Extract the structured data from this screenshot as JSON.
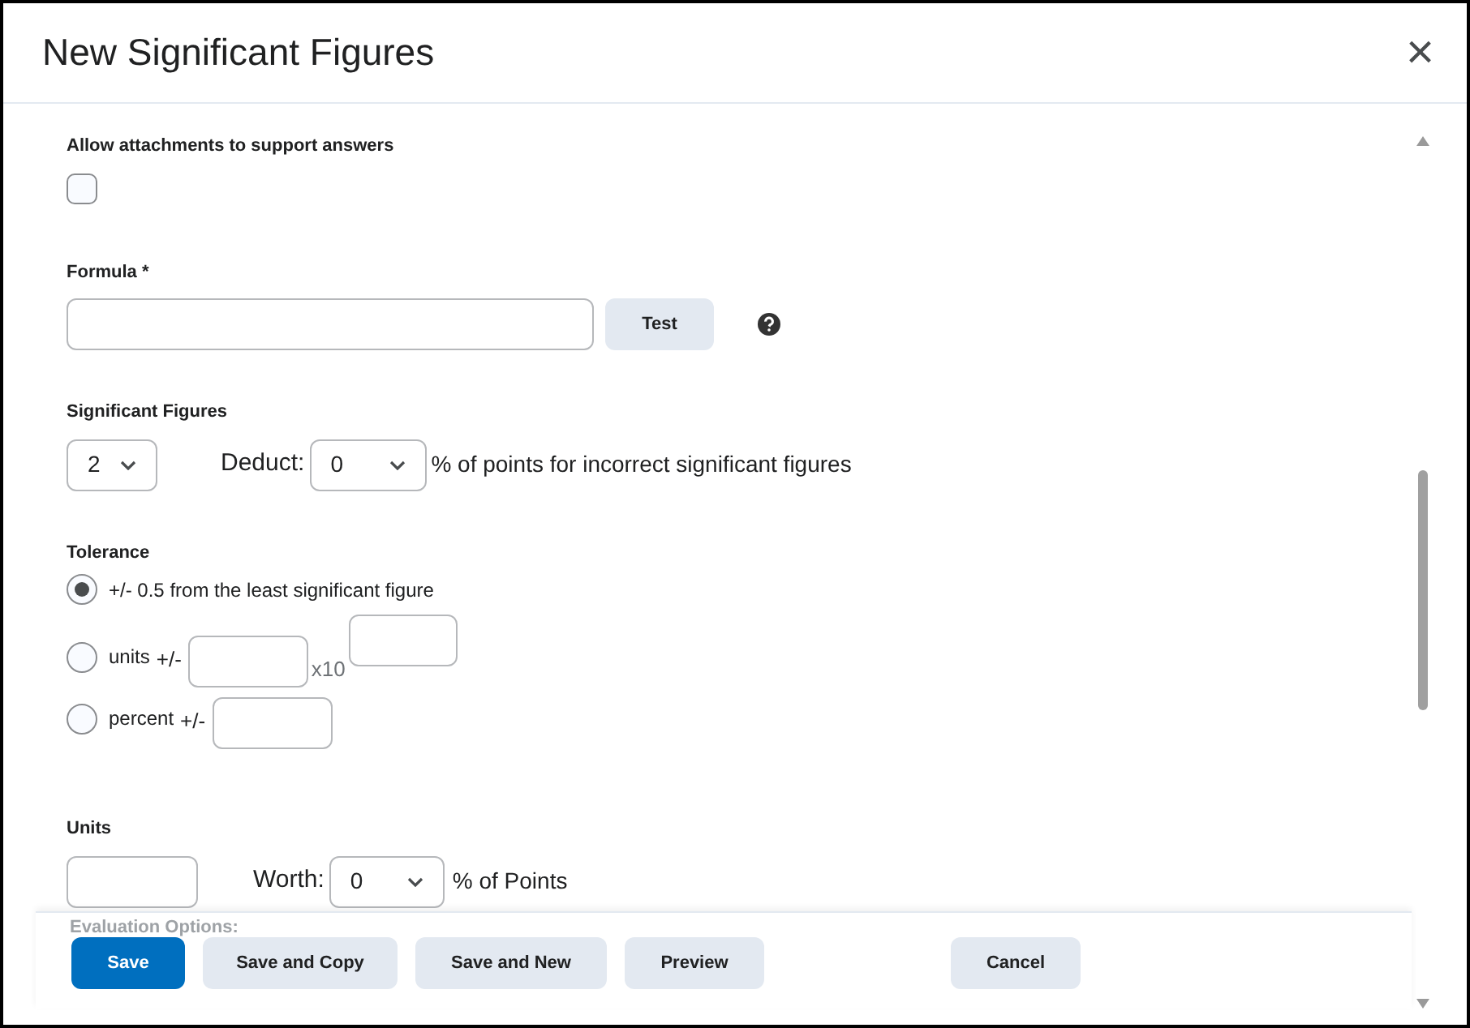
{
  "window": {
    "title": "New Significant Figures",
    "close": "×"
  },
  "attachments": {
    "label": "Allow attachments to support answers",
    "checked": false
  },
  "formula": {
    "label": "Formula *",
    "test_button": "Test"
  },
  "significant_figures": {
    "label": "Significant Figures",
    "value": "2",
    "deduct_label": "Deduct:",
    "deduct_value": "0",
    "deduct_suffix": "% of points for incorrect significant figures"
  },
  "tolerance": {
    "label": "Tolerance",
    "options": [
      {
        "kind": "plain",
        "label": "+/- 0.5 from the least significant figure",
        "selected": true
      },
      {
        "kind": "units",
        "label": "units",
        "prefix": "+/-",
        "exponent_label": "x10",
        "selected": false
      },
      {
        "kind": "percent",
        "label": "percent",
        "prefix": "+/-",
        "selected": false
      }
    ]
  },
  "units": {
    "label": "Units",
    "worth_label": "Worth:",
    "worth_value": "0",
    "worth_suffix": "% of Points"
  },
  "evaluation_options": {
    "label": "Evaluation Options:"
  },
  "footer": {
    "buttons": [
      {
        "label": "Save",
        "primary": true
      },
      {
        "label": "Save and Copy",
        "primary": false
      },
      {
        "label": "Save and New",
        "primary": false
      },
      {
        "label": "Preview",
        "primary": false
      },
      {
        "label": "Cancel",
        "primary": false
      }
    ]
  }
}
